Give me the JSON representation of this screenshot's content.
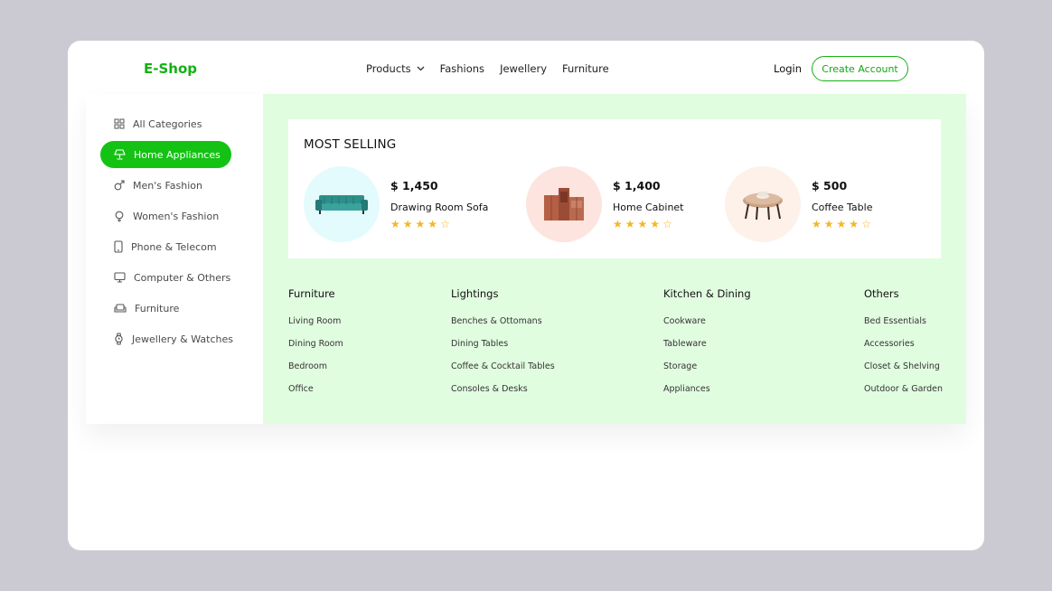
{
  "header": {
    "logo": "E-Shop",
    "nav": [
      {
        "label": "Products",
        "has_dropdown": true
      },
      {
        "label": "Fashions"
      },
      {
        "label": "Jewellery"
      },
      {
        "label": "Furniture"
      }
    ],
    "login_label": "Login",
    "create_account_label": "Create Account"
  },
  "sidebar": {
    "items": [
      {
        "label": "All Categories",
        "icon": "grid-icon"
      },
      {
        "label": "Home Appliances",
        "icon": "lamp-icon",
        "active": true
      },
      {
        "label": "Men's Fashion",
        "icon": "male-icon"
      },
      {
        "label": "Women's Fashion",
        "icon": "female-icon"
      },
      {
        "label": "Phone & Telecom",
        "icon": "phone-icon"
      },
      {
        "label": "Computer & Others",
        "icon": "monitor-icon"
      },
      {
        "label": "Furniture",
        "icon": "sofa-icon"
      },
      {
        "label": "Jewellery & Watches",
        "icon": "watch-icon"
      }
    ]
  },
  "most_selling": {
    "title": "MOST SELLING",
    "products": [
      {
        "price": "$ 1,450",
        "name": "Drawing Room Sofa",
        "rating": 4,
        "max_rating": 5,
        "bg": "#e3fbfc"
      },
      {
        "price": "$ 1,400",
        "name": "Home Cabinet",
        "rating": 4,
        "max_rating": 5,
        "bg": "#fde4de"
      },
      {
        "price": "$ 500",
        "name": "Coffee Table",
        "rating": 4,
        "max_rating": 5,
        "bg": "#fdf1ea"
      }
    ]
  },
  "columns": [
    {
      "title": "Furniture",
      "links": [
        "Living Room",
        "Dining Room",
        "Bedroom",
        "Office"
      ]
    },
    {
      "title": "Lightings",
      "links": [
        "Benches & Ottomans",
        "Dining Tables",
        "Coffee & Cocktail Tables",
        "Consoles & Desks"
      ]
    },
    {
      "title": "Kitchen & Dining",
      "links": [
        "Cookware",
        "Tableware",
        "Storage",
        "Appliances"
      ]
    },
    {
      "title": "Others",
      "links": [
        "Bed Essentials",
        "Accessories",
        "Closet & Shelving",
        "Outdoor & Garden"
      ]
    }
  ],
  "colors": {
    "brand": "#14b014",
    "active_bg": "#14c214",
    "panel_bg": "#e1fde0",
    "star": "#f3b626",
    "page_bg": "#cbcad3"
  }
}
